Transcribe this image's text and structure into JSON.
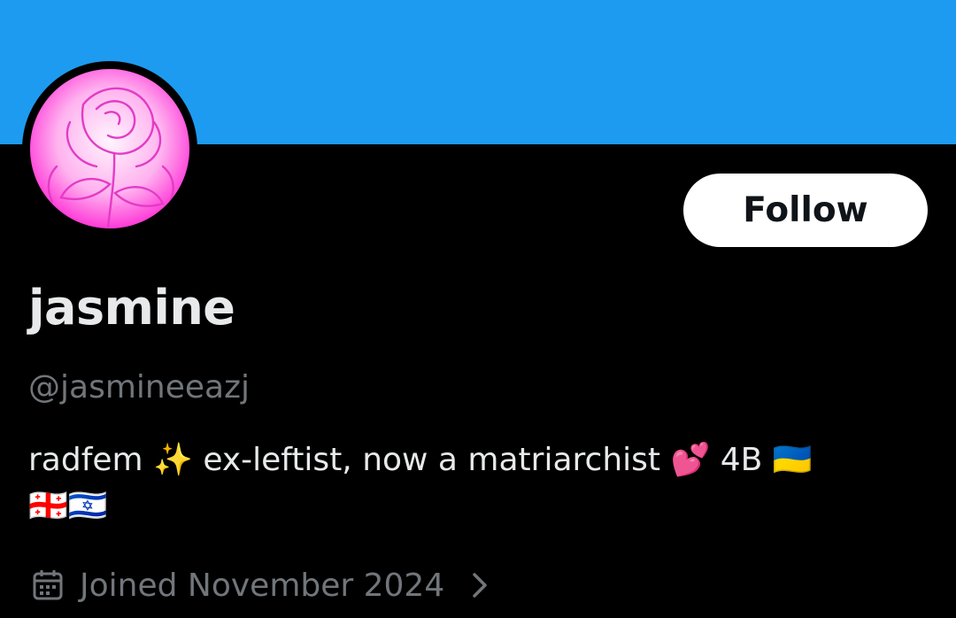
{
  "profile": {
    "display_name": "jasmine",
    "handle": "@jasmineeazj",
    "bio_line1": "radfem ✨ ex-leftist, now a matriarchist 💕  4B  🇺🇦",
    "bio_line2": "🇬🇪🇮🇱",
    "joined": "Joined November 2024"
  },
  "actions": {
    "follow_label": "Follow"
  },
  "icons": {
    "joined": "calendar-icon",
    "expand": "chevron-right-icon"
  },
  "colors": {
    "banner": "#1d9bf0",
    "background": "#000000",
    "primary_text": "#e7e9ea",
    "secondary_text": "#71767b",
    "follow_button_bg": "#ffffff",
    "follow_button_text": "#0f1419",
    "avatar_accent": "#ff1fd2"
  }
}
